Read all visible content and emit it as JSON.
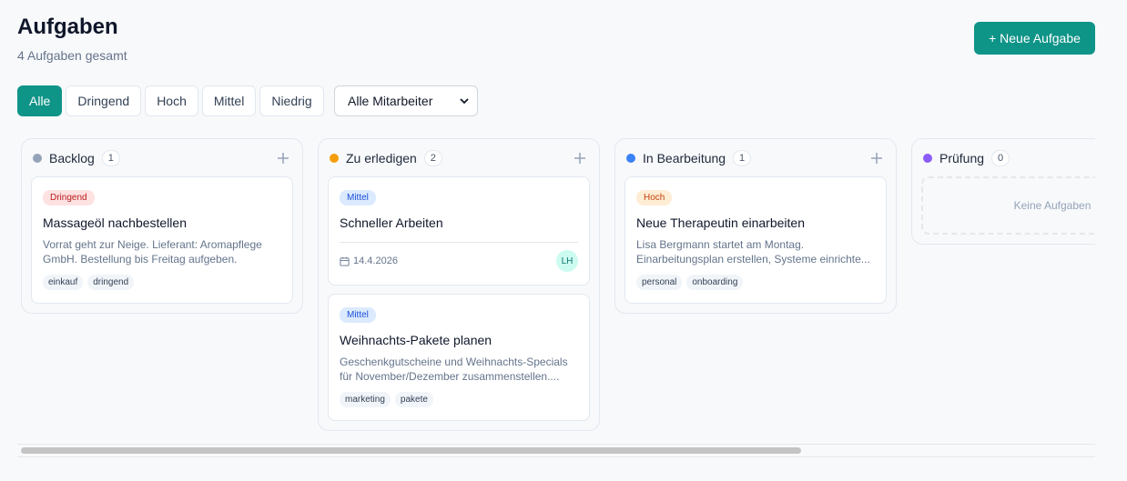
{
  "header": {
    "title": "Aufgaben",
    "subtitle": "4 Aufgaben gesamt",
    "new_task_label": "+ Neue Aufgabe"
  },
  "filters": {
    "priority": [
      "Alle",
      "Dringend",
      "Hoch",
      "Mittel",
      "Niedrig"
    ],
    "active": "Alle",
    "employee_select": "Alle Mitarbeiter"
  },
  "columns": [
    {
      "title": "Backlog",
      "count": "1",
      "color": "#94a3b8",
      "cards": [
        {
          "priority": "Dringend",
          "title": "Massageöl nachbestellen",
          "description_lines": [
            "Vorrat geht zur Neige. Lieferant: Aromapflege",
            "GmbH. Bestellung bis Freitag aufgeben."
          ],
          "tags": [
            "einkauf",
            "dringend"
          ]
        }
      ]
    },
    {
      "title": "Zu erledigen",
      "count": "2",
      "color": "#f59e0b",
      "cards": [
        {
          "priority": "Mittel",
          "title": "Schneller Arbeiten",
          "date": "14.4.2026",
          "assignee": "LH"
        },
        {
          "priority": "Mittel",
          "title": "Weihnachts-Pakete planen",
          "description_lines": [
            "Geschenkgutscheine und Weihnachts-Specials",
            "für November/Dezember zusammenstellen...."
          ],
          "tags": [
            "marketing",
            "pakete"
          ]
        }
      ]
    },
    {
      "title": "In Bearbeitung",
      "count": "1",
      "color": "#3b82f6",
      "cards": [
        {
          "priority": "Hoch",
          "title": "Neue Therapeutin einarbeiten",
          "description_lines": [
            "Lisa Bergmann startet am Montag.",
            "Einarbeitungsplan erstellen, Systeme einrichte..."
          ],
          "tags": [
            "personal",
            "onboarding"
          ]
        }
      ]
    },
    {
      "title": "Prüfung",
      "count": "0",
      "color": "#8b5cf6",
      "empty_label": "Keine Aufgaben"
    }
  ]
}
